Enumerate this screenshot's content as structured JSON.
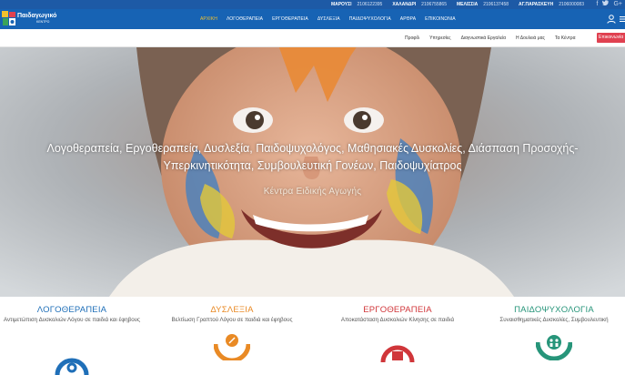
{
  "colors": {
    "topbar": "#1d5aa6",
    "navbar": "#1763b4",
    "active_menu": "#f2c12e",
    "contact_button": "#e04150",
    "service_blue": "#1f6fb8",
    "service_orange": "#e98a25",
    "service_red": "#d0363a",
    "service_green": "#27957a"
  },
  "topbar": {
    "phones": [
      {
        "area": "ΜΑΡΟΥΣΙ",
        "number": "2106122395"
      },
      {
        "area": "ΧΑΛΑΝΔΡΙ",
        "number": "2106755865"
      },
      {
        "area": "ΜΕΛΙΣΣΙΑ",
        "number": "2106137458"
      },
      {
        "area": "ΑΓ.ΠΑΡΑΣΚΕΥΗ",
        "number": "2106000083"
      }
    ],
    "social_icons": [
      "facebook-icon",
      "twitter-icon",
      "google-plus-icon"
    ]
  },
  "logo": {
    "title": "Παιδαγωγικό",
    "subtitle": "ΚΕΝΤΡΟ"
  },
  "menu": {
    "items": [
      "ΑΡΧΙΚΗ",
      "ΛΟΓΟΘΕΡΑΠΕΙΑ",
      "ΕΡΓΟΘΕΡΑΠΕΙΑ",
      "ΔΥΣΛΕΞΙΑ",
      "ΠΑΙΔΟΨΥΧΟΛΟΓΙΑ",
      "ΑΡΘΡΑ",
      "ΕΠΙΚΟΙΝΩΝΙΑ"
    ],
    "active_index": 0
  },
  "subnav": {
    "links": [
      "Προφίλ",
      "Υπηρεσίες",
      "Διαγνωστικά Εργαλεία",
      "Η Δουλειά μας",
      "Τα Κέντρα"
    ],
    "contact_label": "Επικοινωνία"
  },
  "hero": {
    "title_line1": "Λογοθεραπεία, Εργοθεραπεία, Δυσλεξία, Παιδοψυχολόγος, Μαθησιακές Δυσκολίες, Διάσπαση Προσοχής-",
    "title_line2": "Υπερκινητικότητα, Συμβουλευτική Γονέων, Παιδοψυχίατρος",
    "subtitle": "Κέντρα Ειδικής Αγωγής"
  },
  "services": [
    {
      "title": "ΛΟΓΟΘΕΡΑΠΕΙΑ",
      "description": "Αντιμετώπιση Δυσκολιών Λόγου σε παιδιά και έφηβους",
      "icon": "speech-icon"
    },
    {
      "title": "ΔΥΣΛΕΞΙΑ",
      "description": "Βελτίωση Γραπτού Λόγου σε παιδιά και έφηβους",
      "icon": "pencil-icon"
    },
    {
      "title": "ΕΡΓΟΘΕΡΑΠΕΙΑ",
      "description": "Αποκατάσταση Δυσκολιών Κίνησης σε παιδιά",
      "icon": "movement-icon"
    },
    {
      "title": "ΠΑΙΔΟΨΥΧΟΛΟΓΙΑ",
      "description": "Συναισθηματικές Δυσκολίες, Συμβουλευτική",
      "icon": "family-icon"
    }
  ]
}
